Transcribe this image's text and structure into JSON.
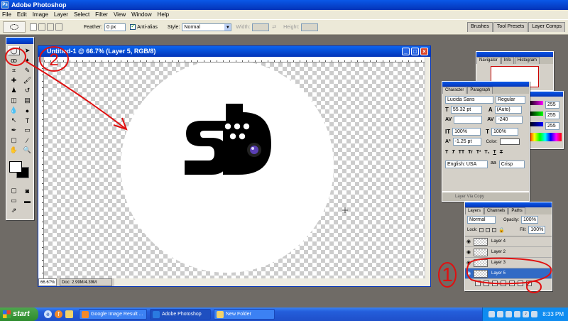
{
  "app": {
    "title": "Adobe Photoshop"
  },
  "menu": [
    "File",
    "Edit",
    "Image",
    "Layer",
    "Select",
    "Filter",
    "View",
    "Window",
    "Help"
  ],
  "options": {
    "feather_label": "Feather:",
    "feather_value": "0 px",
    "antialias_label": "Anti-alias",
    "style_label": "Style:",
    "style_value": "Normal",
    "width_label": "Width:",
    "height_label": "Height:"
  },
  "palette_well": [
    "Brushes",
    "Tool Presets",
    "Layer Comps"
  ],
  "document": {
    "title": "Untitled-1 @ 66.7% (Layer 5, RGB/8)",
    "zoom": "66.67%",
    "doc_size": "Doc: 2.99M/4.39M"
  },
  "navigator": {
    "tabs": [
      "Navigator",
      "Info",
      "Histogram"
    ]
  },
  "color_values": [
    "255",
    "255",
    "255"
  ],
  "character": {
    "tabs": [
      "Character",
      "Paragraph"
    ],
    "font_family": "Lucida Sans",
    "font_style": "Regular",
    "size": "55.32 pt",
    "leading": "(Auto)",
    "tracking": "-240",
    "vscale": "100%",
    "hscale": "100%",
    "baseline": "-1.25 pt",
    "color_label": "Color:",
    "language": "English: USA",
    "antialias": "Crisp",
    "type_buttons": [
      "T",
      "T",
      "TT",
      "Tr",
      "T¹",
      "T₁",
      "T",
      "T"
    ]
  },
  "history_peek": {
    "label": "Layer Via Copy"
  },
  "layers": {
    "tabs": [
      "Layers",
      "Channels",
      "Paths"
    ],
    "blend": "Normal",
    "opacity_label": "Opacity:",
    "opacity": "100%",
    "lock_label": "Lock:",
    "fill_label": "Fill:",
    "fill": "100%",
    "items": [
      "Layer 4",
      "Layer 2",
      "Layer 3",
      "Layer 5"
    ]
  },
  "taskbar": {
    "start": "start",
    "buttons": [
      "Google Image Result ...",
      "Adobe Photoshop",
      "New Folder"
    ],
    "time": "8:33 PM"
  },
  "annotations": {
    "one": "1",
    "two": "2"
  },
  "colors": {
    "selection_blue": "#316ac5",
    "annotation_red": "#e01010",
    "logo_black": "#000000"
  }
}
